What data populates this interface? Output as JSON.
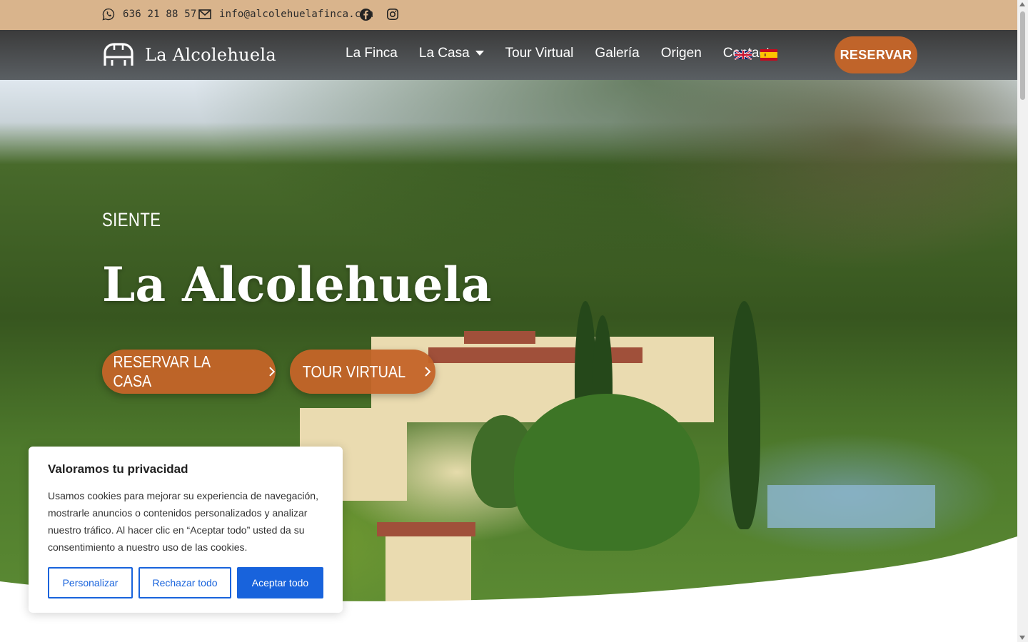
{
  "topbar": {
    "phone": "636 21 88 57",
    "email": "info@alcolehuelafinca.com",
    "icons": [
      "whatsapp-icon",
      "mail-icon",
      "facebook-icon",
      "instagram-icon"
    ]
  },
  "nav": {
    "logo_text": "La Alcolehuela",
    "items": [
      {
        "label": "La Finca"
      },
      {
        "label": "La Casa"
      },
      {
        "label": "Tour Virtual"
      },
      {
        "label": "Galería"
      },
      {
        "label": "Origen"
      },
      {
        "label": "Contacto"
      }
    ],
    "languages": [
      "en-flag",
      "es-flag"
    ],
    "reserve_label": "RESERVAR"
  },
  "hero": {
    "kicker": "SIENTE",
    "title": "La Alcolehuela",
    "cta_primary": "RESERVAR LA CASA",
    "cta_secondary": "TOUR VIRTUAL"
  },
  "cookie": {
    "title": "Valoramos tu privacidad",
    "body": "Usamos cookies para mejorar su experiencia de navegación, mostrarle anuncios o contenidos personalizados y analizar nuestro tráfico. Al hacer clic en “Aceptar todo” usted da su consentimiento a nuestro uso de las cookies.",
    "customize": "Personalizar",
    "reject": "Rechazar todo",
    "accept": "Aceptar todo"
  },
  "colors": {
    "topbar": "#d9b48c",
    "accent": "#c0642a",
    "cookie_blue": "#1863dc"
  }
}
